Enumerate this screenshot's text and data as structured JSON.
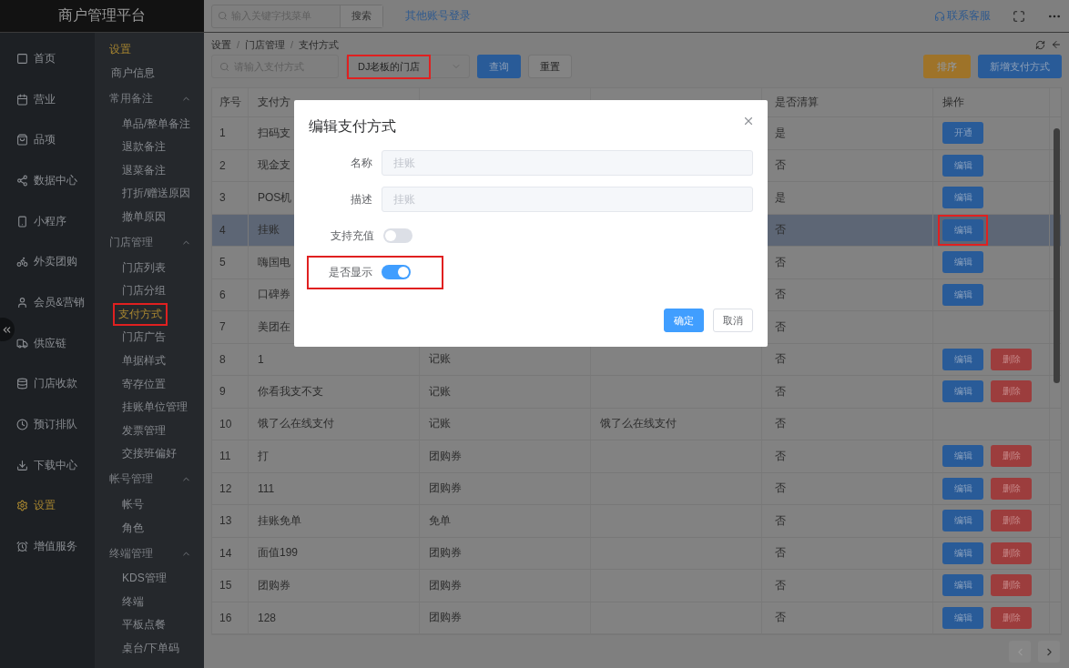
{
  "topbar": {
    "brand": "商户管理平台",
    "search_placeholder": "输入关键字找菜单",
    "search_button": "搜索",
    "switch_link": "其他账号登录",
    "support_link": "联系客服"
  },
  "main_nav": [
    {
      "label": "首页",
      "selected": false
    },
    {
      "label": "营业",
      "selected": false
    },
    {
      "label": "品项",
      "selected": false
    },
    {
      "label": "数据中心",
      "selected": false
    },
    {
      "label": "小程序",
      "selected": false
    },
    {
      "label": "外卖团购",
      "selected": false
    },
    {
      "label": "会员&营销",
      "selected": false
    },
    {
      "label": "供应链",
      "selected": false
    },
    {
      "label": "门店收款",
      "selected": false
    },
    {
      "label": "预订排队",
      "selected": false
    },
    {
      "label": "下载中心",
      "selected": false
    },
    {
      "label": "设置",
      "selected": true
    },
    {
      "label": "增值服务",
      "selected": false
    }
  ],
  "sub_nav": {
    "title": "设置",
    "items": [
      {
        "kind": "link",
        "label": "商户信息",
        "selected": false
      },
      {
        "kind": "group",
        "label": "常用备注",
        "expanded": true,
        "children": [
          {
            "label": "单品/整单备注",
            "selected": false
          },
          {
            "label": "退款备注",
            "selected": false
          },
          {
            "label": "退菜备注",
            "selected": false
          },
          {
            "label": "打折/赠送原因",
            "selected": false
          },
          {
            "label": "撤单原因",
            "selected": false
          }
        ]
      },
      {
        "kind": "group",
        "label": "门店管理",
        "expanded": true,
        "children": [
          {
            "label": "门店列表",
            "selected": false
          },
          {
            "label": "门店分组",
            "selected": false
          },
          {
            "label": "支付方式",
            "selected": true,
            "marked": true
          },
          {
            "label": "门店广告",
            "selected": false
          },
          {
            "label": "单据样式",
            "selected": false
          },
          {
            "label": "寄存位置",
            "selected": false
          },
          {
            "label": "挂账单位管理",
            "selected": false
          },
          {
            "label": "发票管理",
            "selected": false
          },
          {
            "label": "交接班偏好",
            "selected": false
          }
        ]
      },
      {
        "kind": "group",
        "label": "帐号管理",
        "expanded": true,
        "children": [
          {
            "label": "帐号",
            "selected": false
          },
          {
            "label": "角色",
            "selected": false
          }
        ]
      },
      {
        "kind": "group",
        "label": "终端管理",
        "expanded": true,
        "children": [
          {
            "label": "KDS管理",
            "selected": false
          },
          {
            "label": "终端",
            "selected": false
          },
          {
            "label": "平板点餐",
            "selected": false
          },
          {
            "label": "桌台/下单码",
            "selected": false
          }
        ]
      }
    ]
  },
  "breadcrumb": {
    "separator": "/",
    "items": [
      "设置",
      "门店管理",
      "支付方式"
    ]
  },
  "toolbar": {
    "search_placeholder": "请输入支付方式",
    "store": {
      "value": "DJ老板的门店",
      "marked": true
    },
    "query_button": "查询",
    "reset_button": "重置",
    "sort_button": "排序",
    "add_button": "新增支付方式"
  },
  "table": {
    "header": {
      "number": "序号",
      "name": "支付方",
      "settled": "是否清算",
      "actions": "操作"
    },
    "rows": [
      {
        "no": "1",
        "name": "扫码支",
        "settled": "是",
        "selected": false,
        "actions": [
          {
            "label": "开通",
            "kind": "primary"
          }
        ]
      },
      {
        "no": "2",
        "name": "现金支",
        "settled": "否",
        "selected": false,
        "actions": [
          {
            "label": "编辑",
            "kind": "primary"
          }
        ]
      },
      {
        "no": "3",
        "name": "POS机",
        "settled": "是",
        "selected": false,
        "actions": [
          {
            "label": "编辑",
            "kind": "primary"
          }
        ]
      },
      {
        "no": "4",
        "name": "挂账",
        "settled": "否",
        "selected": true,
        "actions": [
          {
            "label": "编辑",
            "kind": "primary",
            "marked": true
          }
        ]
      },
      {
        "no": "5",
        "name": "嗨国电",
        "settled": "否",
        "selected": false,
        "actions": [
          {
            "label": "编辑",
            "kind": "primary"
          }
        ]
      },
      {
        "no": "6",
        "name": "口碑券",
        "settled": "否",
        "selected": false,
        "actions": [
          {
            "label": "编辑",
            "kind": "primary"
          }
        ]
      },
      {
        "no": "7",
        "name": "美团在",
        "settled": "否",
        "selected": false
      },
      {
        "no": "8",
        "name": "1",
        "type": "记账",
        "settled": "否",
        "selected": false,
        "actions": [
          {
            "label": "编辑",
            "kind": "primary"
          },
          {
            "label": "删除",
            "kind": "danger"
          }
        ]
      },
      {
        "no": "9",
        "name": "你看我支不支",
        "type": "记账",
        "settled": "否",
        "selected": false,
        "actions": [
          {
            "label": "编辑",
            "kind": "primary"
          },
          {
            "label": "删除",
            "kind": "danger"
          }
        ]
      },
      {
        "no": "10",
        "name": "饿了么在线支付",
        "type": "记账",
        "description": "饿了么在线支付",
        "settled": "否",
        "selected": false
      },
      {
        "no": "11",
        "name": "打",
        "type": "团购券",
        "settled": "否",
        "selected": false,
        "actions": [
          {
            "label": "编辑",
            "kind": "primary"
          },
          {
            "label": "删除",
            "kind": "danger"
          }
        ]
      },
      {
        "no": "12",
        "name": "111",
        "type": "团购券",
        "settled": "否",
        "selected": false,
        "actions": [
          {
            "label": "编辑",
            "kind": "primary"
          },
          {
            "label": "删除",
            "kind": "danger"
          }
        ]
      },
      {
        "no": "13",
        "name": "挂账免单",
        "type": "免单",
        "settled": "否",
        "selected": false,
        "actions": [
          {
            "label": "编辑",
            "kind": "primary"
          },
          {
            "label": "删除",
            "kind": "danger"
          }
        ]
      },
      {
        "no": "14",
        "name": "面值199",
        "type": "团购券",
        "settled": "否",
        "selected": false,
        "actions": [
          {
            "label": "编辑",
            "kind": "primary"
          },
          {
            "label": "删除",
            "kind": "danger"
          }
        ]
      },
      {
        "no": "15",
        "name": "团购券",
        "type": "团购券",
        "settled": "否",
        "selected": false,
        "actions": [
          {
            "label": "编辑",
            "kind": "primary"
          },
          {
            "label": "删除",
            "kind": "danger"
          }
        ]
      },
      {
        "no": "16",
        "name": "128",
        "type": "团购券",
        "settled": "否",
        "selected": false,
        "actions": [
          {
            "label": "编辑",
            "kind": "primary"
          },
          {
            "label": "删除",
            "kind": "danger"
          }
        ]
      }
    ]
  },
  "modal": {
    "title": "编辑支付方式",
    "fields": [
      {
        "kind": "input",
        "label": "名称",
        "placeholder": "挂账"
      },
      {
        "kind": "input",
        "label": "描述",
        "placeholder": "挂账"
      },
      {
        "kind": "switch",
        "label": "支持充值",
        "on": false
      },
      {
        "kind": "switch",
        "label": "是否显示",
        "on": true,
        "marked": true
      }
    ],
    "confirm_button": "确定",
    "cancel_button": "取消"
  }
}
